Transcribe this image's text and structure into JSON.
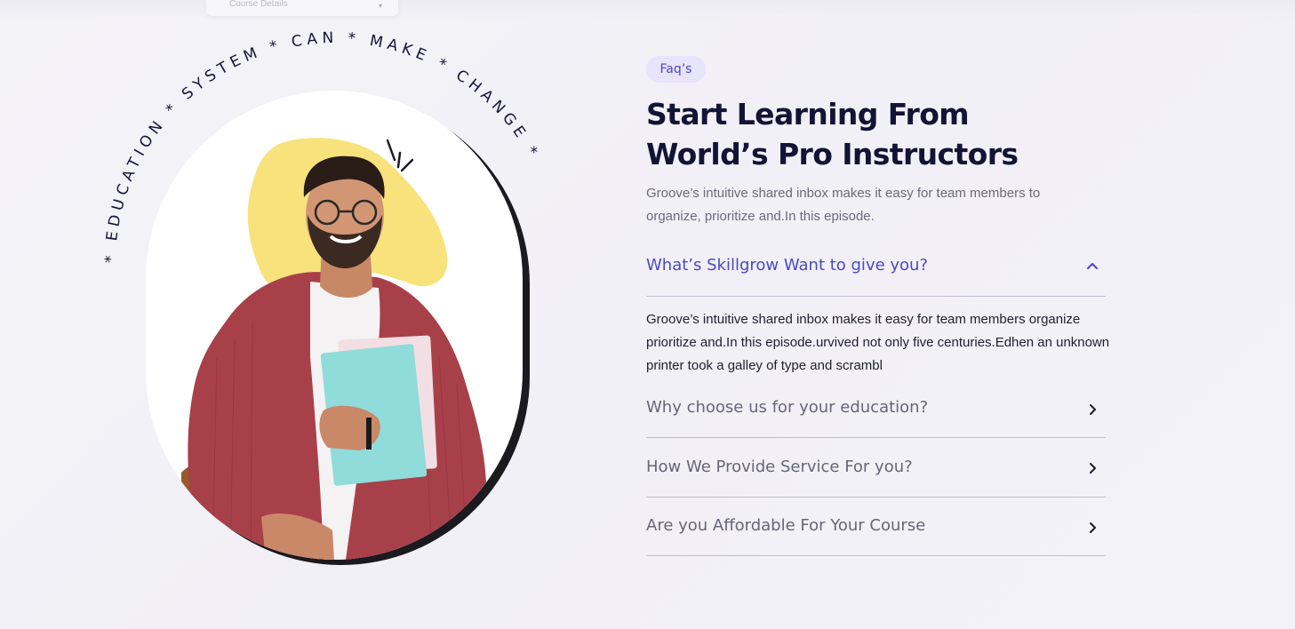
{
  "top_card": {
    "label": "Course Details"
  },
  "ring_text": "* EDUCATION * SYSTEM * CAN * MAKE * CHANGE *",
  "faq_section": {
    "badge": "Faq’s",
    "heading_line1": "Start Learning From",
    "heading_line2": "World’s Pro Instructors",
    "intro": "Groove’s intuitive shared inbox makes it easy for team members to organize, prioritize and.In this episode.",
    "items": [
      {
        "question": "What’s Skillgrow Want to give you?",
        "expanded": true,
        "icon": "chevron-up-icon"
      },
      {
        "question": "Why choose us for your education?",
        "expanded": false,
        "icon": "chevron-right-icon"
      },
      {
        "question": "How We Provide Service For you?",
        "expanded": false,
        "icon": "chevron-right-icon"
      },
      {
        "question": "Are you Affordable For Your Course",
        "expanded": false,
        "icon": "chevron-right-icon"
      }
    ],
    "active_answer": "Groove’s intuitive shared inbox makes it easy for team members organize prioritize and.In this episode.urvived not only five centuries.Edhen an unknown printer took a galley of type and scrambl"
  },
  "colors": {
    "accent": "#4b47c7",
    "heading": "#131336",
    "badge_bg": "#e7e4fb",
    "blob": "#f8e27c",
    "shirt": "#a8404a"
  }
}
